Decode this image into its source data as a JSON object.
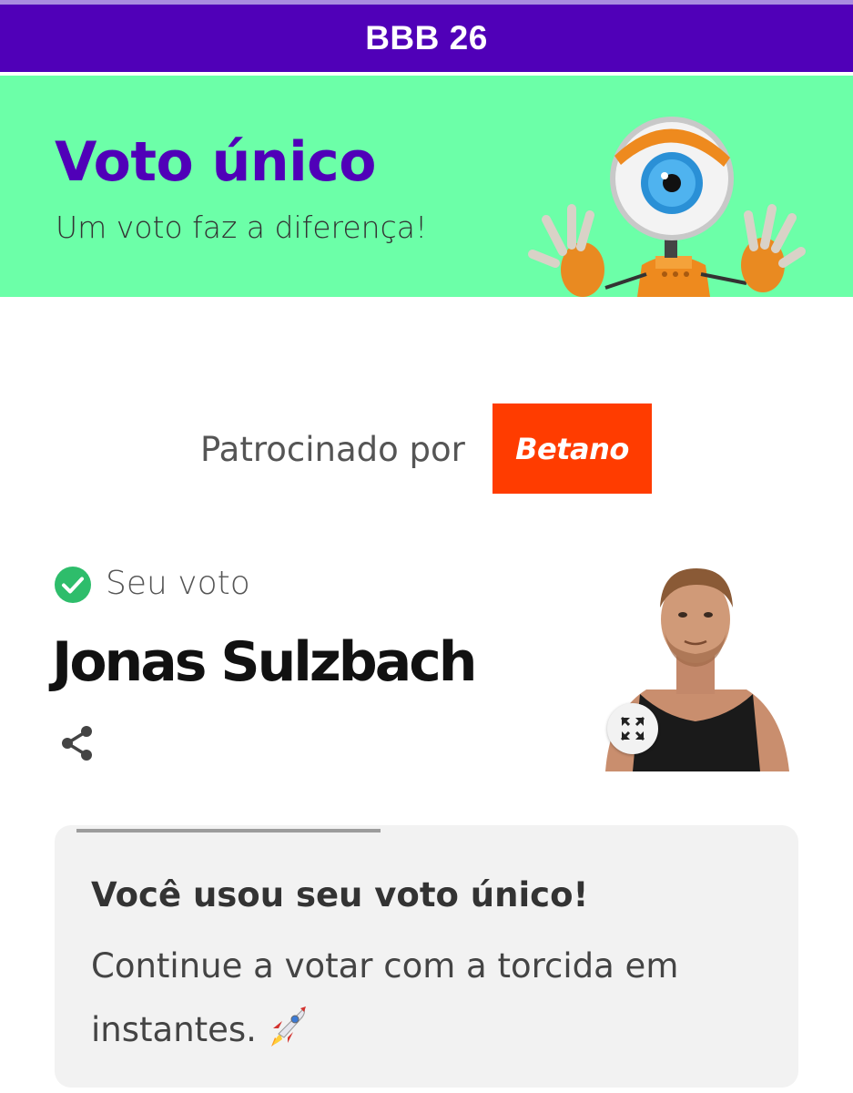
{
  "header": {
    "title": "BBB 26"
  },
  "hero": {
    "title": "Voto único",
    "subtitle": "Um voto faz a diferença!",
    "mascot_icon": "big-brother-eye-mascot",
    "background": "#6cffa8",
    "title_color": "#5000b8"
  },
  "sponsor": {
    "label": "Patrocinado por",
    "brand": "Betano",
    "brand_color": "#ff3c00"
  },
  "vote": {
    "status_label": "Seu voto",
    "status_icon": "check-circle-icon",
    "candidate_name": "Jonas Sulzbach",
    "share_icon": "share-icon",
    "expand_icon": "expand-icon"
  },
  "notice": {
    "title": "Você usou seu voto único!",
    "message": "Continue a votar com a torcida em instantes.",
    "emoji_icon": "rocket-icon"
  },
  "colors": {
    "brand_purple": "#5000b8",
    "success_green": "#2ebd6b",
    "card_bg": "#f2f2f2"
  }
}
